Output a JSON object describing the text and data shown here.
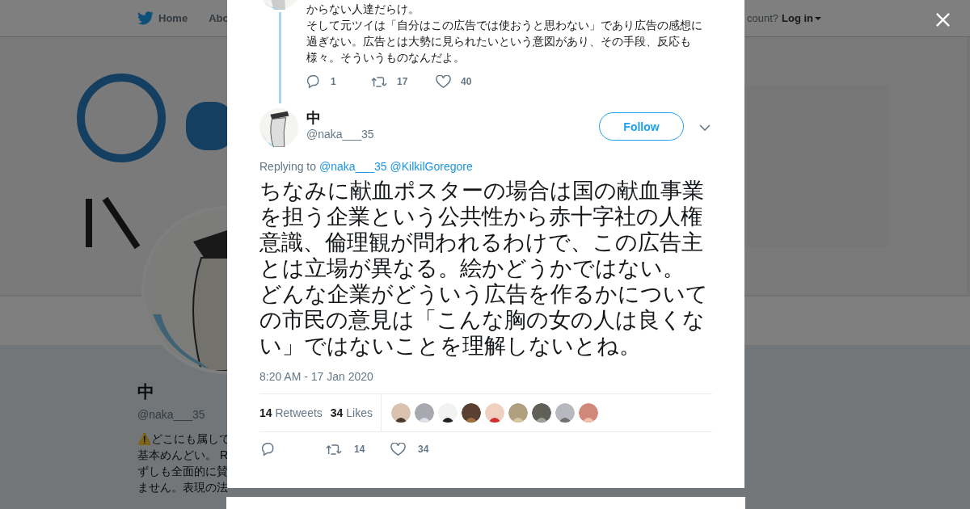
{
  "nav": {
    "items": [
      {
        "label": "Home"
      },
      {
        "label": "Abo"
      }
    ],
    "account_prompt": "count?",
    "login": "Log in"
  },
  "profile": {
    "name": "中",
    "handle": "@naka___35",
    "bio_lines": [
      "⚠️どこにも属して",
      "基本めんどい。 R",
      "ずしも全面的に賛",
      "ません。表現の法"
    ]
  },
  "modal": {
    "previous_tweet": {
      "paragraphs": [
        "からない人達だらけ。",
        "そして元ツイは「自分はこの広告では使おうと思わない」であり広告の感想に過ぎない。広告とは大勢に見られたいという意図があり、その手段、反応も様々。そういうものなんだよ。"
      ],
      "replies": "1",
      "retweets": "17",
      "likes": "40"
    },
    "tweet": {
      "name": "中",
      "handle": "@naka___35",
      "follow": "Follow",
      "replying_label": "Replying to",
      "replying_to": [
        "@naka___35",
        "@KilkilGoregore"
      ],
      "paragraphs": [
        "ちなみに献血ポスターの場合は国の献血事業を担う企業という公共性から赤十字社の人権意識、倫理観が問われるわけで、この広告主とは立場が異なる。絵かどうかではない。",
        "どんな企業がどういう広告を作るかについての市民の意見は「こんな胸の女の人は良くない」ではないことを理解しないとね。"
      ],
      "timestamp": "8:20 AM - 17 Jan 2020",
      "stats": [
        {
          "count": "14",
          "label": "Retweets"
        },
        {
          "count": "34",
          "label": "Likes"
        }
      ],
      "retweets": "14",
      "likes": "34"
    }
  }
}
